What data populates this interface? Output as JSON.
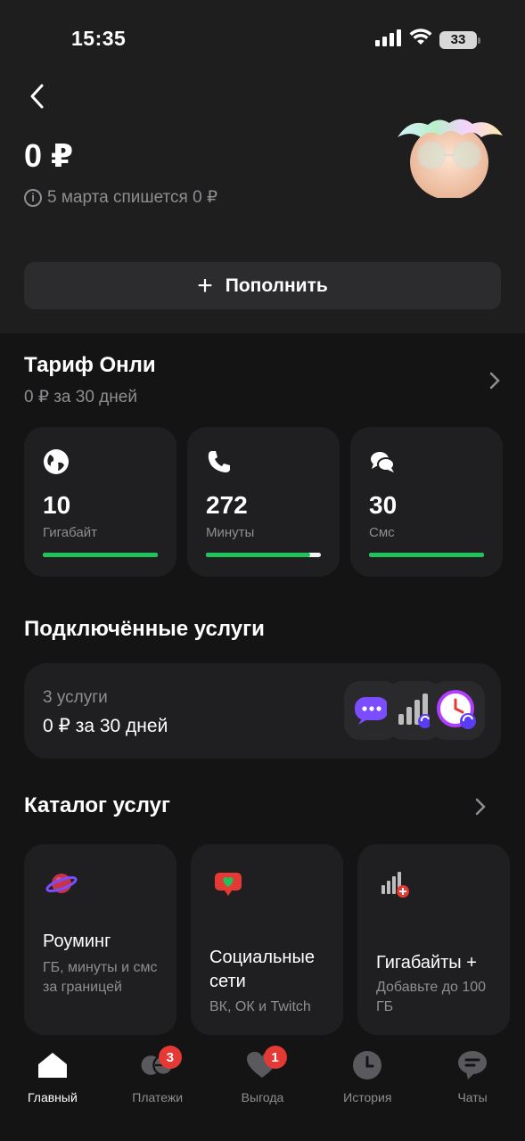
{
  "status_bar": {
    "time": "15:35",
    "battery": "33"
  },
  "balance": {
    "amount": "0 ₽",
    "note": "5 марта спишется 0 ₽"
  },
  "topup": {
    "label": "Пополнить"
  },
  "tariff": {
    "title": "Тариф Онли",
    "price": "0 ₽ за 30 дней",
    "cards": [
      {
        "icon": "globe-icon",
        "value": "10",
        "label": "Гигабайт",
        "remaining": 1.0
      },
      {
        "icon": "phone-icon",
        "value": "272",
        "label": "Минуты",
        "remaining": 0.91
      },
      {
        "icon": "chat-bubbles-icon",
        "value": "30",
        "label": "Смс",
        "remaining": 1.0
      }
    ]
  },
  "services": {
    "title": "Подключённые услуги",
    "count": "3 услуги",
    "price": "0 ₽ за 30 дней",
    "icons": [
      "message-bubble-icon",
      "signal-bars-icon",
      "clock-icon"
    ]
  },
  "catalog": {
    "title": "Каталог услуг",
    "items": [
      {
        "icon": "planet-icon",
        "title": "Роуминг",
        "desc": "ГБ, минуты и смс за границей"
      },
      {
        "icon": "heart-message-icon",
        "title": "Социальные сети",
        "desc": "ВК, ОК и Twitch"
      },
      {
        "icon": "signal-plus-icon",
        "title": "Гигабайты +",
        "desc": "Добавьте до 100 ГБ"
      }
    ]
  },
  "tabbar": {
    "tabs": [
      {
        "icon": "home-icon",
        "label": "Главный",
        "active": true
      },
      {
        "icon": "payments-icon",
        "label": "Платежи",
        "badge": "3"
      },
      {
        "icon": "heart-icon",
        "label": "Выгода",
        "badge": "1"
      },
      {
        "icon": "history-icon",
        "label": "История"
      },
      {
        "icon": "chat-icon",
        "label": "Чаты"
      }
    ]
  },
  "colors": {
    "accent_green": "#1ec35a",
    "badge_red": "#e53935",
    "card_bg": "#1f1f21",
    "muted_text": "#8e8e93"
  }
}
